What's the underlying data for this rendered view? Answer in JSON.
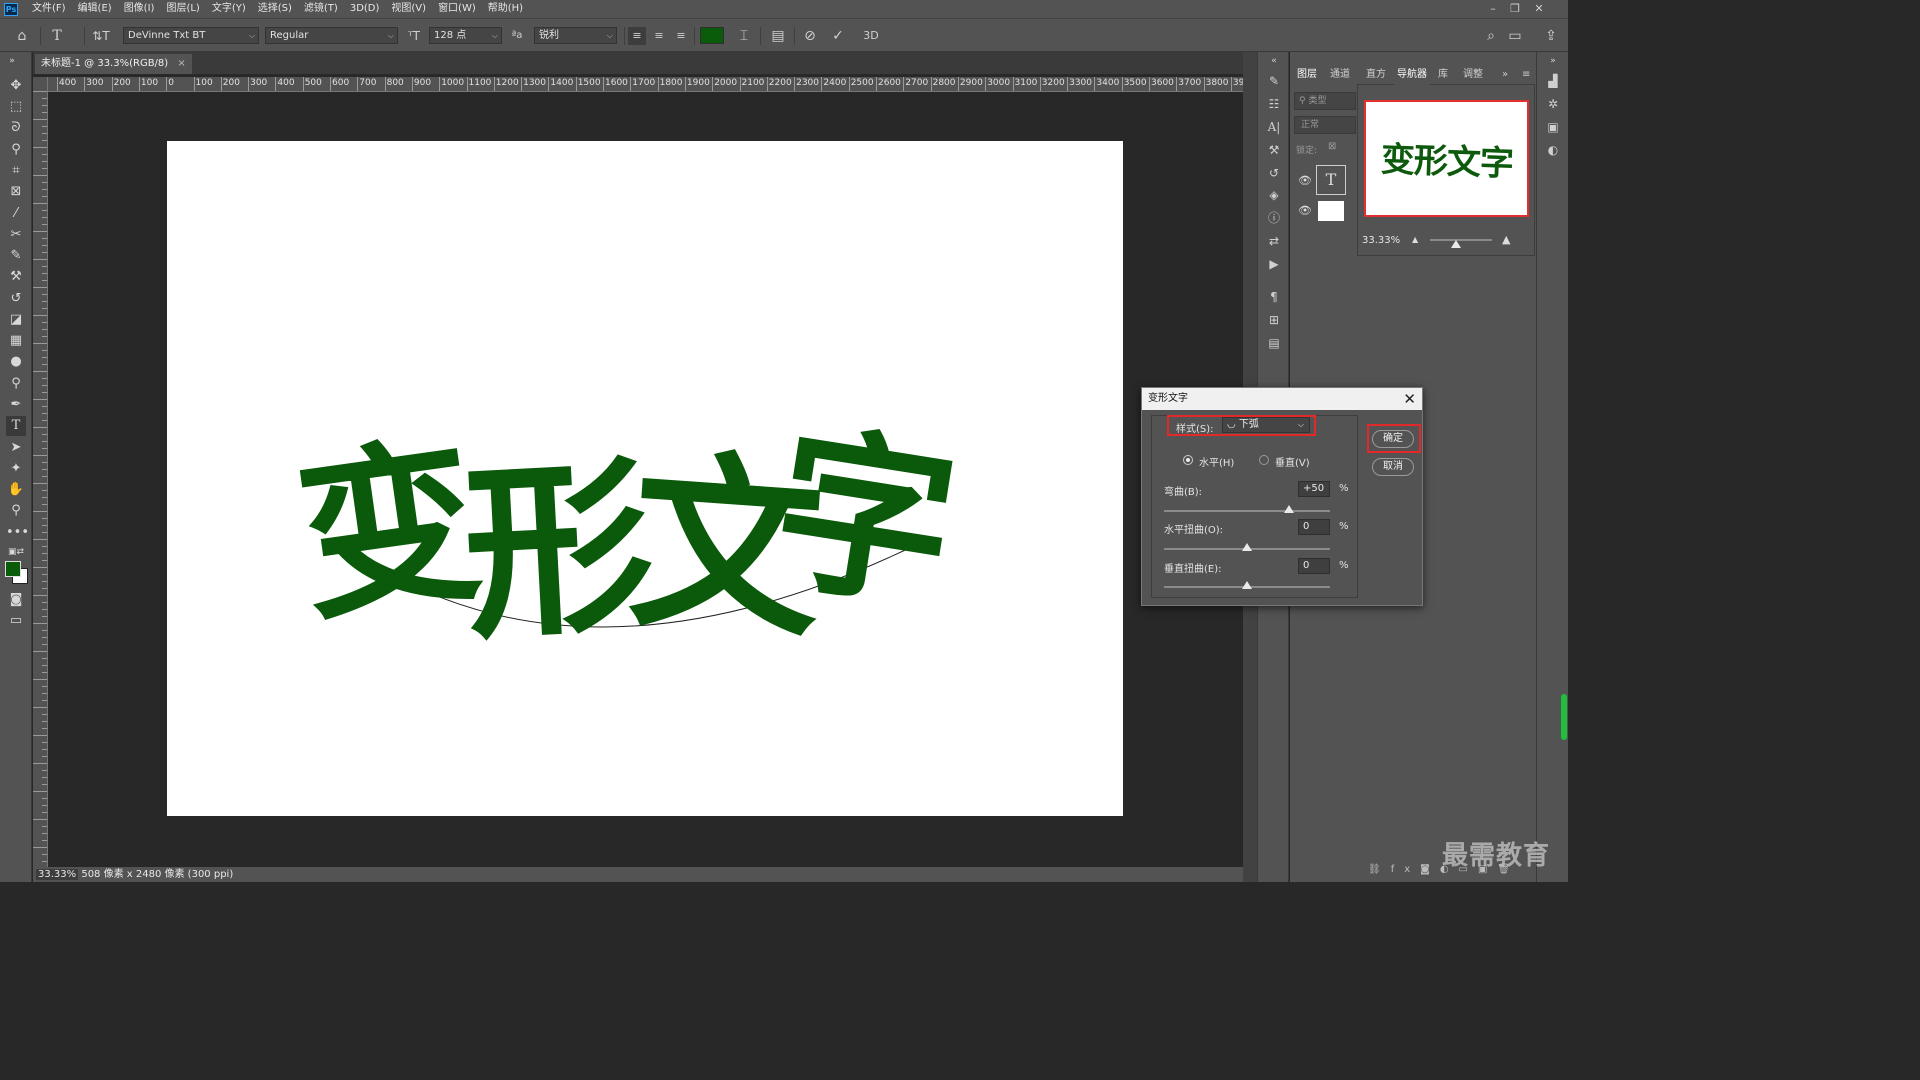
{
  "menubar": {
    "logo": "Ps",
    "items": [
      "文件(F)",
      "编辑(E)",
      "图像(I)",
      "图层(L)",
      "文字(Y)",
      "选择(S)",
      "滤镜(T)",
      "3D(D)",
      "视图(V)",
      "窗口(W)",
      "帮助(H)"
    ]
  },
  "options": {
    "font_family": "DeVinne Txt BT",
    "font_style": "Regular",
    "font_size": "128 点",
    "antialias_label": "ªa",
    "antialias": "锐利",
    "text_color": "#0a5c0a",
    "label_3d": "3D"
  },
  "document": {
    "tab_title": "未标题-1 @ 33.3%(RGB/8)",
    "tab_close": "×",
    "canvas_text": "变形文字",
    "text_color": "#0b5a0b"
  },
  "ruler": {
    "labels": [
      "400",
      "300",
      "200",
      "100",
      "0",
      "100",
      "200",
      "300",
      "400",
      "500",
      "600",
      "700",
      "800",
      "900",
      "1000",
      "1100",
      "1200",
      "1300",
      "1400",
      "1500",
      "1600",
      "1700",
      "1800",
      "1900",
      "2000",
      "2100",
      "2200",
      "2300",
      "2400",
      "2500",
      "2600",
      "2700",
      "2800",
      "2900",
      "3000",
      "3100",
      "3200",
      "3300",
      "3400",
      "3500",
      "3600",
      "3700",
      "3800",
      "39"
    ]
  },
  "status": {
    "zoom": "33.33%",
    "info": "508 像素 x 2480 像素 (300 ppi)"
  },
  "panels": {
    "layers_tabs": [
      "图层",
      "通道"
    ],
    "nav_tabs": [
      "直方",
      "导航器",
      "库",
      "调整"
    ],
    "search_placeholder": "类型",
    "blend_mode": "正常",
    "lock_label": "锁定:",
    "navigator_zoom": "33.33%"
  },
  "dialog": {
    "title": "变形文字",
    "style_label": "样式(S):",
    "style_value": "下弧",
    "orientation_horizontal": "水平(H)",
    "orientation_vertical": "垂直(V)",
    "bend_label": "弯曲(B):",
    "bend_value": "+50",
    "hdistort_label": "水平扭曲(O):",
    "hdistort_value": "0",
    "vdistort_label": "垂直扭曲(E):",
    "vdistort_value": "0",
    "percent": "%",
    "ok": "确定",
    "cancel": "取消"
  },
  "watermark": "最需教育"
}
